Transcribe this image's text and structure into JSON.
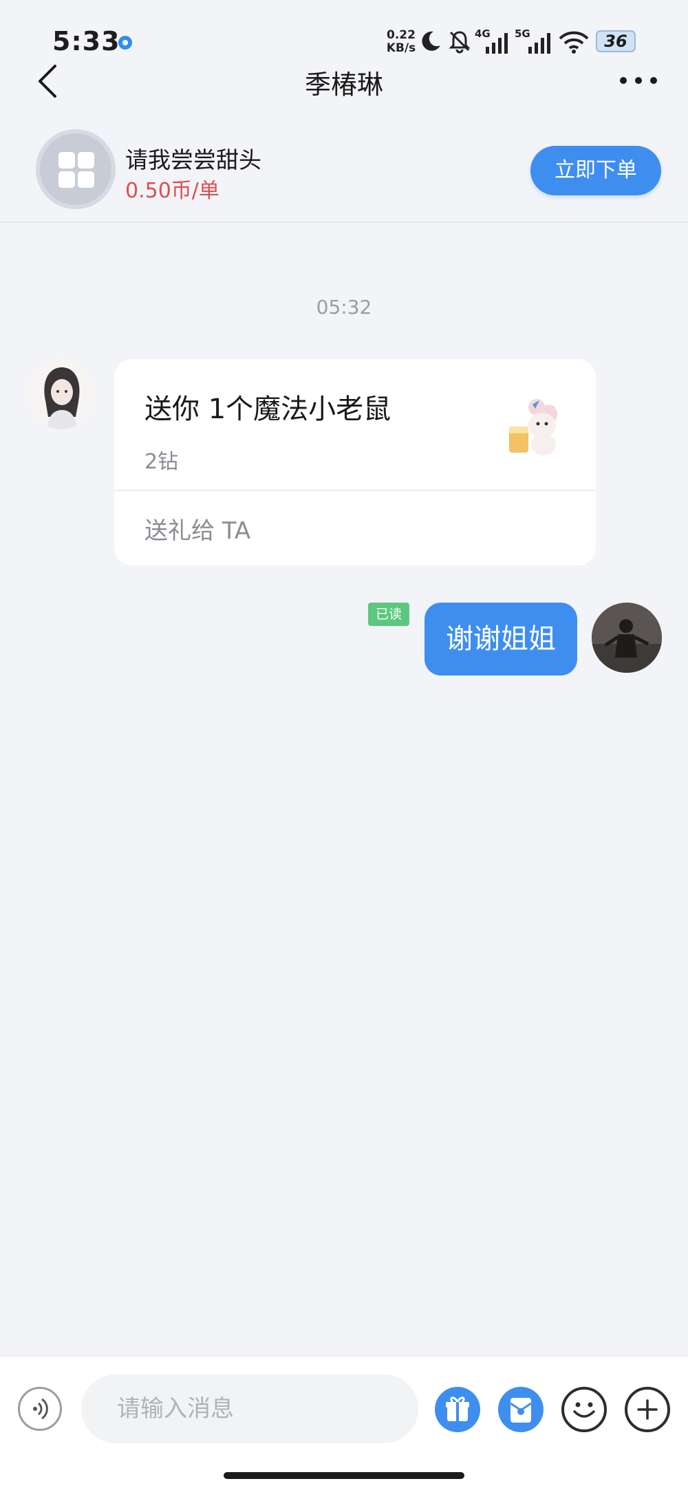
{
  "status_bar": {
    "time": "5:33",
    "net_speed_value": "0.22",
    "net_speed_unit": "KB/s",
    "net_4g": "4G",
    "net_5g": "5G",
    "battery": "36"
  },
  "nav": {
    "title": "季椿琳",
    "icons": [
      "chevron-left-icon",
      "more-icon"
    ]
  },
  "service": {
    "name": "请我尝尝甜头",
    "price": "0.50币/单",
    "order_label": "立即下单"
  },
  "chat": {
    "timestamp": "05:32",
    "gift_card": {
      "title": "送你 1个魔法小老鼠",
      "price": "2钻",
      "action": "送礼给 TA"
    },
    "read_badge": "已读",
    "outgoing_message": "谢谢姐姐"
  },
  "input_bar": {
    "placeholder": "请输入消息",
    "icons": [
      "voice-icon",
      "gift-icon",
      "red-packet-icon",
      "emoji-icon",
      "plus-icon"
    ]
  },
  "colors": {
    "accent": "#3e8ef0",
    "price_red": "#e04d4d",
    "read_green": "#5cc77e",
    "background": "#f3f4f8"
  }
}
